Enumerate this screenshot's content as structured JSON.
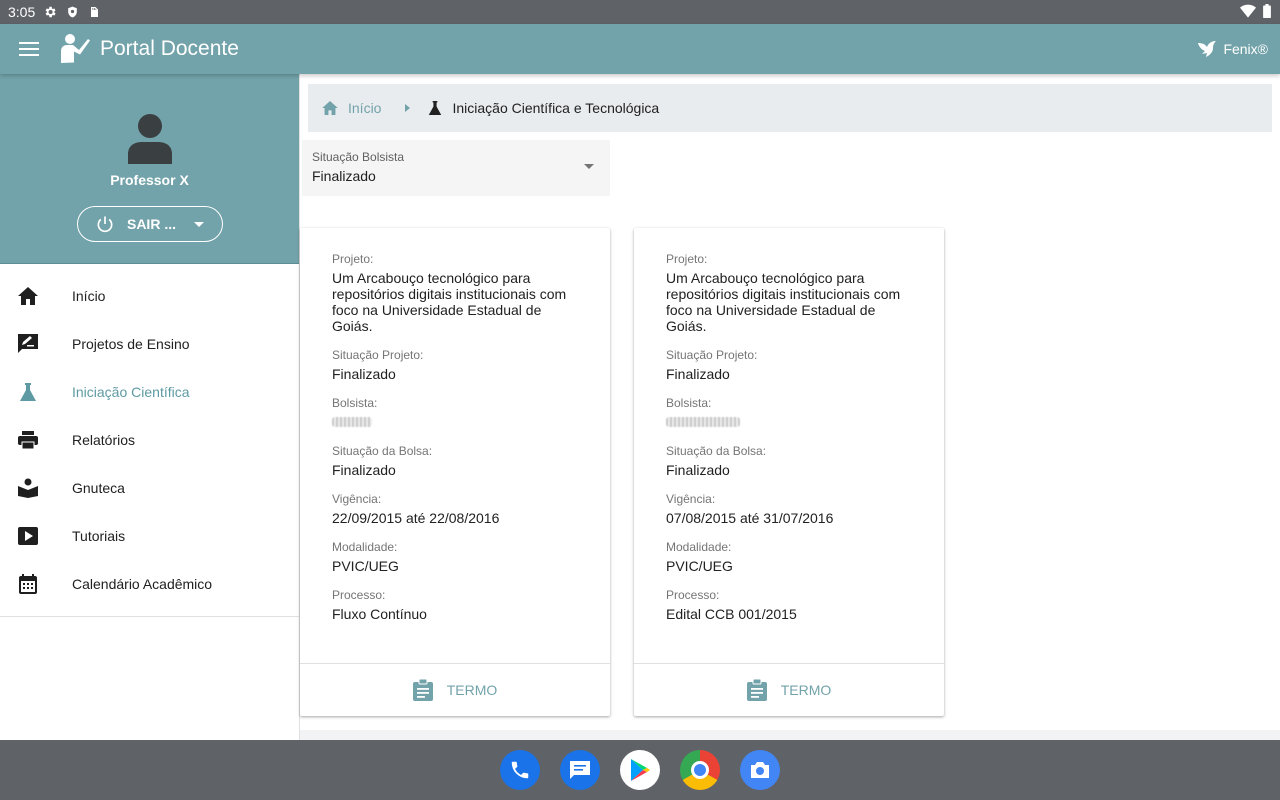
{
  "status_bar": {
    "time": "3:05"
  },
  "app_bar": {
    "title": "Portal Docente",
    "brand": "Fenix®"
  },
  "sidebar": {
    "user_name": "Professor X",
    "logout_label": "SAIR ...",
    "items": [
      {
        "label": "Início",
        "icon": "home-icon",
        "active": false
      },
      {
        "label": "Projetos de Ensino",
        "icon": "rate-review-icon",
        "active": false
      },
      {
        "label": "Iniciação Científica",
        "icon": "flask-icon",
        "active": true
      },
      {
        "label": "Relatórios",
        "icon": "printer-icon",
        "active": false
      },
      {
        "label": "Gnuteca",
        "icon": "book-reader-icon",
        "active": false
      },
      {
        "label": "Tutoriais",
        "icon": "play-icon",
        "active": false
      },
      {
        "label": "Calendário Acadêmico",
        "icon": "calendar-icon",
        "active": false
      }
    ]
  },
  "breadcrumb": {
    "home": "Início",
    "current": "Iniciação Científica e Tecnológica"
  },
  "filter": {
    "label": "Situação Bolsista",
    "value": "Finalizado"
  },
  "labels": {
    "projeto": "Projeto:",
    "situacao_projeto": "Situação Projeto:",
    "bolsista": "Bolsista:",
    "situacao_bolsa": "Situação da Bolsa:",
    "vigencia": "Vigência:",
    "modalidade": "Modalidade:",
    "processo": "Processo:"
  },
  "cards": [
    {
      "projeto": "Um Arcabouço tecnológico para repositórios digitais institucionais com foco na Universidade Estadual de Goiás.",
      "situacao_projeto": "Finalizado",
      "situacao_bolsa": "Finalizado",
      "vigencia": "22/09/2015 até 22/08/2016",
      "modalidade": "PVIC/UEG",
      "processo": "Fluxo Contínuo",
      "action": "TERMO"
    },
    {
      "projeto": "Um Arcabouço tecnológico para repositórios digitais institucionais com foco na Universidade Estadual de Goiás.",
      "situacao_projeto": "Finalizado",
      "situacao_bolsa": "Finalizado",
      "vigencia": "07/08/2015 até 31/07/2016",
      "modalidade": "PVIC/UEG",
      "processo": "Edital CCB 001/2015",
      "action": "TERMO"
    }
  ],
  "colors": {
    "primary": "#73a3aa",
    "active_nav": "#5e9aa3",
    "status_bar": "#5f6368"
  },
  "taskbar": [
    "phone-icon",
    "messages-icon",
    "play-store-icon",
    "chrome-icon",
    "camera-icon"
  ]
}
